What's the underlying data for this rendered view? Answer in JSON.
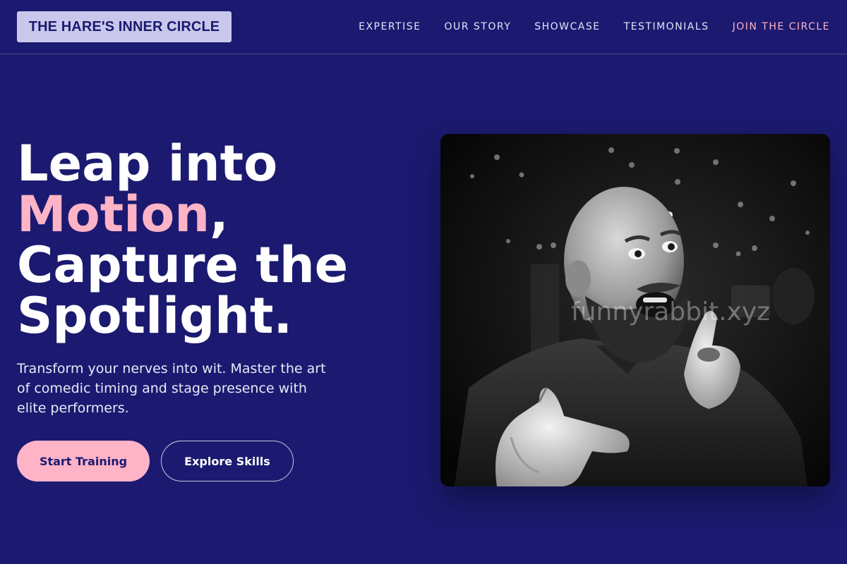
{
  "nav": {
    "logo": "THE HARE'S INNER CIRCLE",
    "links": [
      {
        "label": "EXPERTISE"
      },
      {
        "label": "OUR STORY"
      },
      {
        "label": "SHOWCASE"
      },
      {
        "label": "TESTIMONIALS"
      },
      {
        "label": "JOIN THE CIRCLE"
      }
    ]
  },
  "hero": {
    "title_part1": "Leap into",
    "title_highlight": "Motion",
    "title_comma": ",",
    "title_part2": "Capture the",
    "title_part3": "Spotlight.",
    "subtitle": "Transform your nerves into wit. Master the art of comedic timing and stage presence with elite performers.",
    "primary_button": "Start Training",
    "secondary_button": "Explore Skills",
    "image_watermark": "funnyrabbit.xyz"
  },
  "colors": {
    "background": "#1b1a70",
    "accent_pink": "#ffb3c6",
    "logo_bg": "#c9c8ec"
  }
}
